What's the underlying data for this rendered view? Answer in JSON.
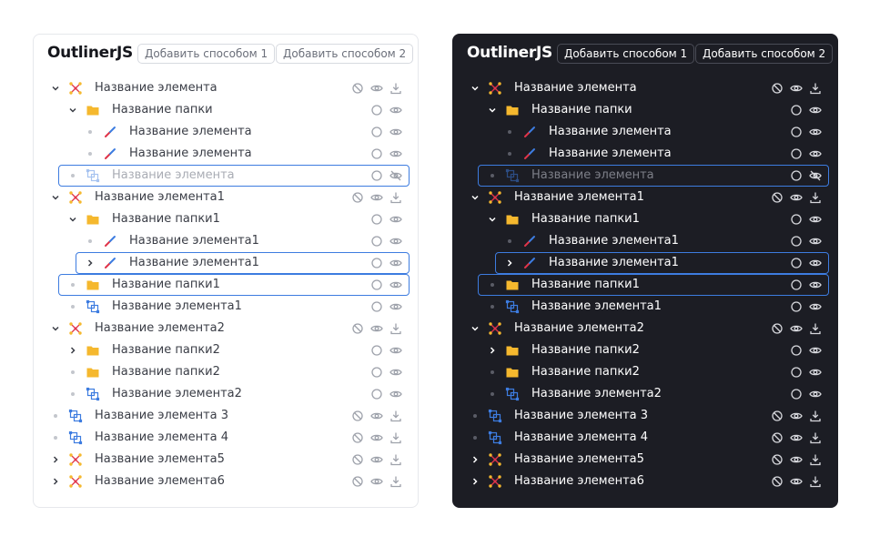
{
  "app_title": "OutlinerJS",
  "buttons": {
    "add_method_1": "Добавить способом 1",
    "add_method_2": "Добавить способом 2"
  },
  "theme_colors": {
    "light_panel_bg": "#ffffff",
    "dark_panel_bg": "#1c1d24",
    "selection_border": "#3d7ce0",
    "folder_yellow": "#f5b82e",
    "route_icon_red": "#e0344a",
    "shape_icon_blue": "#3d7ce0"
  },
  "tree": [
    {
      "label": "Название элемента",
      "icon": "route-icon",
      "level": 0,
      "expander": "expanded",
      "actions": [
        "lock-icon",
        "eye-icon",
        "download-icon"
      ],
      "dim": false,
      "selected": false
    },
    {
      "label": "Название папки",
      "icon": "folder-icon",
      "level": 1,
      "expander": "expanded",
      "actions": [
        "circle-icon",
        "eye-icon"
      ],
      "dim": false,
      "selected": false
    },
    {
      "label": "Название элемента",
      "icon": "line-icon",
      "level": 2,
      "expander": "dot",
      "actions": [
        "circle-icon",
        "eye-icon"
      ],
      "dim": false,
      "selected": false
    },
    {
      "label": "Название элемента",
      "icon": "line-icon",
      "level": 2,
      "expander": "dot",
      "actions": [
        "circle-icon",
        "eye-icon"
      ],
      "dim": false,
      "selected": false
    },
    {
      "label": "Название элемента",
      "icon": "shape-icon",
      "level": 1,
      "expander": "dot",
      "actions": [
        "circle-icon",
        "eye-off-icon"
      ],
      "dim": true,
      "selected": true
    },
    {
      "label": "Название элемента1",
      "icon": "route-icon",
      "level": 0,
      "expander": "expanded",
      "actions": [
        "lock-icon",
        "eye-icon",
        "download-icon"
      ],
      "dim": false,
      "selected": false
    },
    {
      "label": "Название папки1",
      "icon": "folder-icon",
      "level": 1,
      "expander": "expanded",
      "actions": [
        "circle-icon",
        "eye-icon"
      ],
      "dim": false,
      "selected": false
    },
    {
      "label": "Название элемента1",
      "icon": "line-icon",
      "level": 2,
      "expander": "dot",
      "actions": [
        "circle-icon",
        "eye-icon"
      ],
      "dim": false,
      "selected": false
    },
    {
      "label": "Название элемента1",
      "icon": "line-icon",
      "level": 2,
      "expander": "collapsed",
      "actions": [
        "circle-icon",
        "eye-icon"
      ],
      "dim": false,
      "selected": true
    },
    {
      "label": "Название папки1",
      "icon": "folder-icon",
      "level": 1,
      "expander": "dot",
      "actions": [
        "circle-icon",
        "eye-icon"
      ],
      "dim": false,
      "selected": true
    },
    {
      "label": "Название элемента1",
      "icon": "shape-icon",
      "level": 1,
      "expander": "dot",
      "actions": [
        "circle-icon",
        "eye-icon"
      ],
      "dim": false,
      "selected": false
    },
    {
      "label": "Название элемента2",
      "icon": "route-icon",
      "level": 0,
      "expander": "expanded",
      "actions": [
        "lock-icon",
        "eye-icon",
        "download-icon"
      ],
      "dim": false,
      "selected": false
    },
    {
      "label": "Название папки2",
      "icon": "folder-icon",
      "level": 1,
      "expander": "collapsed",
      "actions": [
        "circle-icon",
        "eye-icon"
      ],
      "dim": false,
      "selected": false
    },
    {
      "label": "Название папки2",
      "icon": "folder-icon",
      "level": 1,
      "expander": "dot",
      "actions": [
        "circle-icon",
        "eye-icon"
      ],
      "dim": false,
      "selected": false
    },
    {
      "label": "Название элемента2",
      "icon": "shape-icon",
      "level": 1,
      "expander": "dot",
      "actions": [
        "circle-icon",
        "eye-icon"
      ],
      "dim": false,
      "selected": false
    },
    {
      "label": "Название элемента 3",
      "icon": "shape-icon",
      "level": 0,
      "expander": "dot",
      "actions": [
        "lock-icon",
        "eye-icon",
        "download-icon"
      ],
      "dim": false,
      "selected": false
    },
    {
      "label": "Название элемента 4",
      "icon": "shape-icon",
      "level": 0,
      "expander": "dot",
      "actions": [
        "lock-icon",
        "eye-icon",
        "download-icon"
      ],
      "dim": false,
      "selected": false
    },
    {
      "label": "Название элемента5",
      "icon": "route-icon",
      "level": 0,
      "expander": "collapsed",
      "actions": [
        "lock-icon",
        "eye-icon",
        "download-icon"
      ],
      "dim": false,
      "selected": false
    },
    {
      "label": "Название элемента6",
      "icon": "route-icon",
      "level": 0,
      "expander": "collapsed",
      "actions": [
        "lock-icon",
        "eye-icon",
        "download-icon"
      ],
      "dim": false,
      "selected": false
    }
  ]
}
